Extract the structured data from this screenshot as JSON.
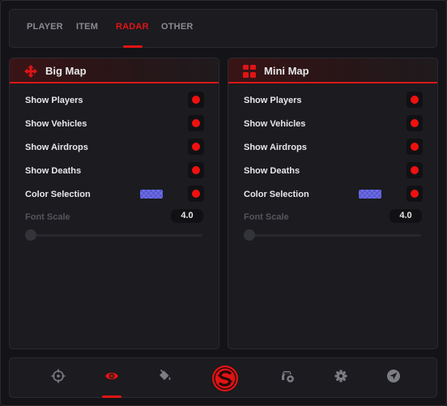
{
  "tabs": [
    {
      "label": "PLAYER",
      "active": false
    },
    {
      "label": "ITEM",
      "active": false
    },
    {
      "label": "RADAR",
      "active": true
    },
    {
      "label": "OTHER",
      "active": false
    }
  ],
  "panels": [
    {
      "title": "Big Map",
      "icon": "move-arrows-icon",
      "rows": [
        {
          "label": "Show Players",
          "enabled": true
        },
        {
          "label": "Show Vehicles",
          "enabled": true
        },
        {
          "label": "Show Airdrops",
          "enabled": true
        },
        {
          "label": "Show Deaths",
          "enabled": true
        },
        {
          "label": "Color Selection",
          "enabled": true
        }
      ],
      "swatch_color": "#5858d8",
      "font_scale": {
        "label": "Font Scale",
        "value": "4.0"
      }
    },
    {
      "title": "Mini Map",
      "icon": "grid-squares-icon",
      "rows": [
        {
          "label": "Show Players",
          "enabled": true
        },
        {
          "label": "Show Vehicles",
          "enabled": true
        },
        {
          "label": "Show Airdrops",
          "enabled": true
        },
        {
          "label": "Show Deaths",
          "enabled": true
        },
        {
          "label": "Color Selection",
          "enabled": true
        }
      ],
      "swatch_color": "#5858d8",
      "font_scale": {
        "label": "Font Scale",
        "value": "4.0"
      }
    }
  ],
  "bottom_nav": [
    {
      "icon": "crosshair-icon",
      "active": false
    },
    {
      "icon": "eye-icon",
      "active": true
    },
    {
      "icon": "paint-bucket-icon",
      "active": false
    },
    {
      "icon": "logo-icon",
      "active": false
    },
    {
      "icon": "car-settings-icon",
      "active": false
    },
    {
      "icon": "gear-icon",
      "active": false
    },
    {
      "icon": "send-icon",
      "active": false
    }
  ],
  "colors": {
    "accent": "#e01414",
    "background": "#141418",
    "panel": "#1b1b20",
    "text": "#e8e8ea",
    "muted": "#8a8a92"
  }
}
